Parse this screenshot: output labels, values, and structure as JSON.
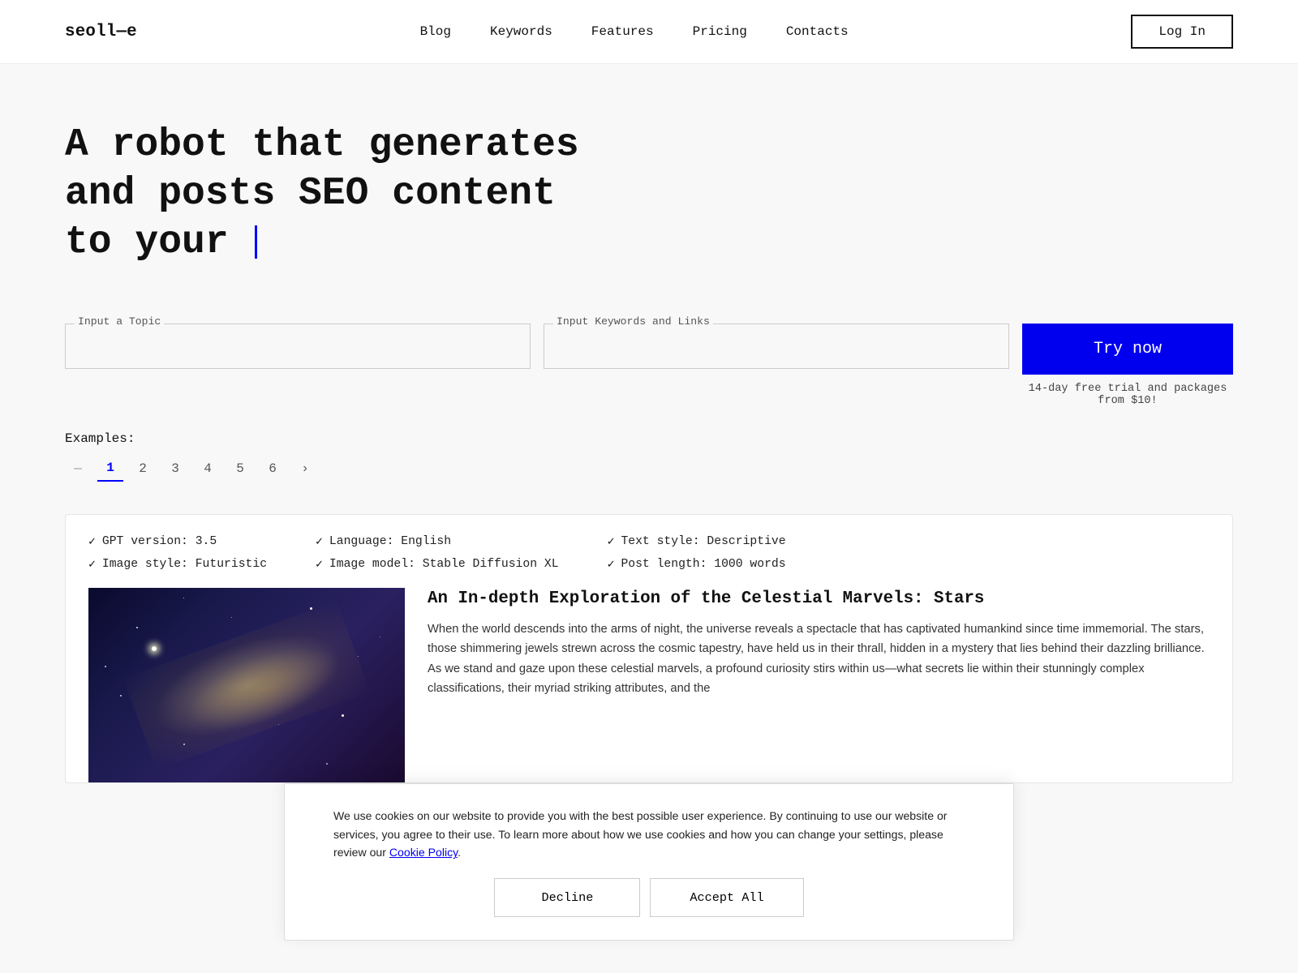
{
  "brand": {
    "logo": "seoll—e"
  },
  "nav": {
    "links": [
      {
        "label": "Blog",
        "href": "#"
      },
      {
        "label": "Keywords",
        "href": "#"
      },
      {
        "label": "Features",
        "href": "#"
      },
      {
        "label": "Pricing",
        "href": "#"
      },
      {
        "label": "Contacts",
        "href": "#"
      }
    ],
    "login_label": "Log In"
  },
  "hero": {
    "line1": "A robot that generates",
    "line2": "and posts SEO content",
    "line3": "to your"
  },
  "input_section": {
    "topic_label": "Input a Topic",
    "topic_placeholder": "",
    "keywords_label": "Input Keywords and Links",
    "keywords_placeholder": "",
    "try_now_label": "Try now",
    "try_now_sub": "14-day free trial and packages\nfrom $10!"
  },
  "examples": {
    "label": "Examples:",
    "pages": [
      "1",
      "2",
      "3",
      "4",
      "5",
      "6"
    ],
    "active_page": "1"
  },
  "card": {
    "meta": [
      [
        {
          "label": "GPT version: 3.5"
        },
        {
          "label": "Image style: Futuristic"
        }
      ],
      [
        {
          "label": "Language: English"
        },
        {
          "label": "Image model: Stable Diffusion XL"
        }
      ],
      [
        {
          "label": "Text style: Descriptive"
        },
        {
          "label": "Post length: 1000 words"
        }
      ]
    ],
    "title": "An In-depth Exploration of the Celestial Marvels: Stars",
    "body_text": "When the world descends into the arms of night, the universe reveals a spectacle that has captivated humankind since time immemorial. The stars, those shimmering jewels strewn across the cosmic tapestry, have held us in their thrall, hidden in a mystery that lies behind their dazzling brilliance. As we stand and gaze upon these celestial marvels, a profound curiosity stirs within us—what secrets lie within their stunningly complex classifications, their myriad striking attributes, and the",
    "link_text": "Cookie Policy"
  },
  "cookie": {
    "text": "We use cookies on our website to provide you with the best possible user experience. By continuing to use our website or services, you agree to their use. To learn more about how we use cookies and how you can change your settings, please review our",
    "link_text": "Cookie Policy",
    "link_suffix": ".",
    "decline_label": "Decline",
    "accept_label": "Accept All"
  }
}
